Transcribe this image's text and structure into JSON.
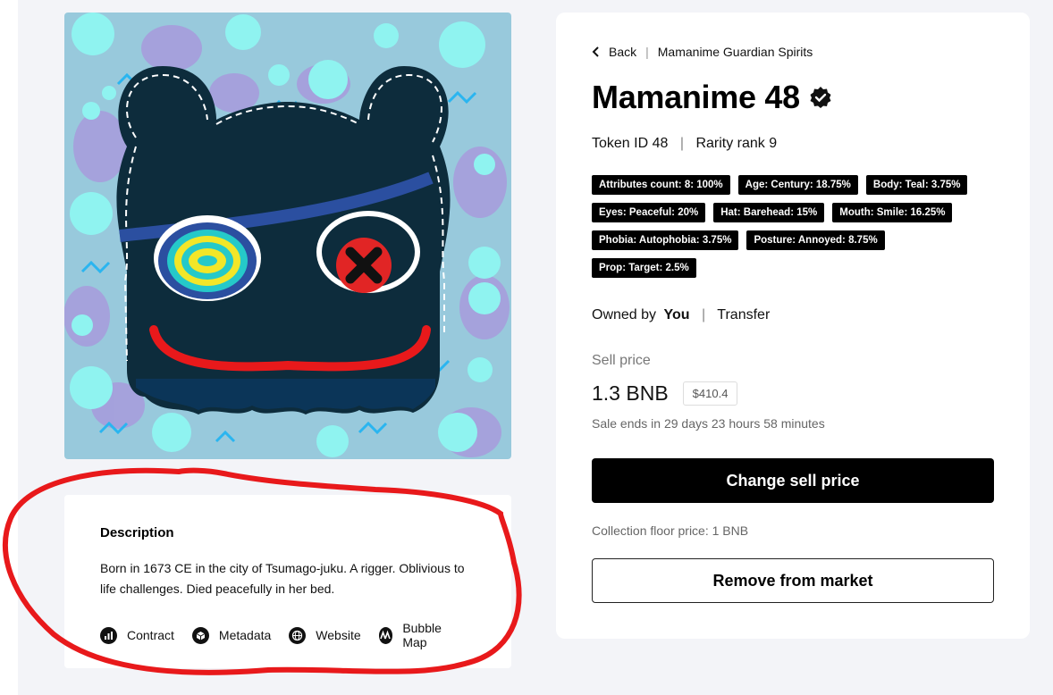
{
  "breadcrumb": {
    "back_label": "Back",
    "collection": "Mamanime Guardian Spirits"
  },
  "nft": {
    "title": "Mamanime 48",
    "token_id": "Token ID 48",
    "rarity": "Rarity rank 9",
    "image_icon": "monster-artwork"
  },
  "attributes": [
    "Attributes count: 8: 100%",
    "Age: Century: 18.75%",
    "Body: Teal: 3.75%",
    "Eyes: Peaceful: 20%",
    "Hat: Barehead: 15%",
    "Mouth: Smile: 16.25%",
    "Phobia: Autophobia: 3.75%",
    "Posture: Annoyed: 8.75%",
    "Prop: Target: 2.5%"
  ],
  "ownership": {
    "owned_prefix": "Owned by",
    "owner": "You",
    "transfer_label": "Transfer"
  },
  "sale": {
    "label": "Sell price",
    "price": "1.3 BNB",
    "usd": "$410.4",
    "ends": "Sale ends in 29 days 23 hours 58 minutes",
    "change_button": "Change sell price",
    "floor": "Collection floor price: 1 BNB",
    "remove_button": "Remove from market"
  },
  "description": {
    "heading": "Description",
    "text": "Born in 1673 CE in the city of Tsumago-juku. A rigger. Oblivious to life challenges. Died peacefully in her bed.",
    "links": [
      {
        "label": "Contract",
        "icon": "chart-icon"
      },
      {
        "label": "Metadata",
        "icon": "cube-icon"
      },
      {
        "label": "Website",
        "icon": "globe-icon"
      },
      {
        "label": "Bubble Map",
        "icon": "bubble-map-icon"
      }
    ]
  },
  "colors": {
    "accent": "#000000",
    "annotation": "#e8191b",
    "background": "#f3f4f8",
    "artwork_bg": "#98c9dc",
    "monster": "#0d2c3c"
  }
}
